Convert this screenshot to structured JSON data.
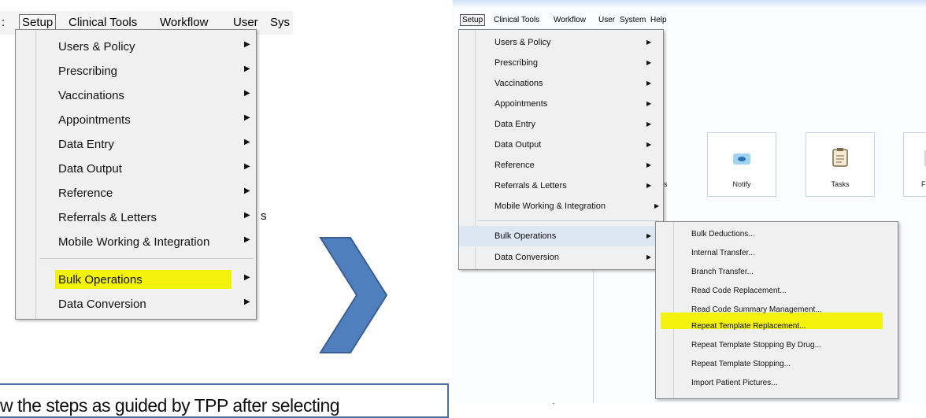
{
  "left_menubar": {
    "items": [
      "Setup",
      "Clinical Tools",
      "Workflow",
      "User",
      "Sys"
    ]
  },
  "left_background": {
    "partial_text": "s"
  },
  "left_setup_menu": {
    "items": [
      {
        "label": "Users & Policy",
        "submenu": true
      },
      {
        "label": "Prescribing",
        "submenu": true
      },
      {
        "label": "Vaccinations",
        "submenu": true
      },
      {
        "label": "Appointments",
        "submenu": true
      },
      {
        "label": "Data Entry",
        "submenu": true
      },
      {
        "label": "Data Output",
        "submenu": true
      },
      {
        "label": "Reference",
        "submenu": true
      },
      {
        "label": "Referrals & Letters",
        "submenu": true
      },
      {
        "label": "Mobile Working & Integration",
        "submenu": true
      },
      {
        "label": "Bulk Operations",
        "submenu": true,
        "highlighted": true
      },
      {
        "label": "Data Conversion",
        "submenu": true
      }
    ]
  },
  "right_menubar": {
    "items": [
      "Setup",
      "Clinical Tools",
      "Workflow",
      "User",
      "System",
      "Help"
    ]
  },
  "right_tiles": [
    {
      "label": "s"
    },
    {
      "label": "Notify",
      "icon": "notify-icon"
    },
    {
      "label": "Tasks",
      "icon": "tasks-icon"
    },
    {
      "label": "Fo"
    }
  ],
  "right_setup_menu": {
    "items": [
      {
        "label": "Users & Policy",
        "submenu": true
      },
      {
        "label": "Prescribing",
        "submenu": true
      },
      {
        "label": "Vaccinations",
        "submenu": true
      },
      {
        "label": "Appointments",
        "submenu": true
      },
      {
        "label": "Data Entry",
        "submenu": true
      },
      {
        "label": "Data Output",
        "submenu": true
      },
      {
        "label": "Reference",
        "submenu": true
      },
      {
        "label": "Referrals & Letters",
        "submenu": true
      },
      {
        "label": "Mobile Working & Integration",
        "submenu": true
      },
      {
        "label": "Bulk Operations",
        "submenu": true,
        "selected": true
      },
      {
        "label": "Data Conversion",
        "submenu": true
      }
    ]
  },
  "bulk_operations_submenu": {
    "items": [
      "Bulk Deductions...",
      "Internal Transfer...",
      "Branch Transfer...",
      "Read Code Replacement...",
      "Read Code Summary Management...",
      "Repeat Template Replacement...",
      "Repeat Template Stopping By Drug...",
      "Repeat Template Stopping...",
      "Import Patient Pictures..."
    ],
    "highlighted_item": "Repeat Template Replacement..."
  },
  "caption": {
    "text": "w the steps as guided by TPP after selecting"
  },
  "colors": {
    "highlight": "#f2f20d",
    "chevron_fill": "#4f7fbd",
    "chevron_stroke": "#3a5f93",
    "menu_bg": "#f0f0f0"
  }
}
